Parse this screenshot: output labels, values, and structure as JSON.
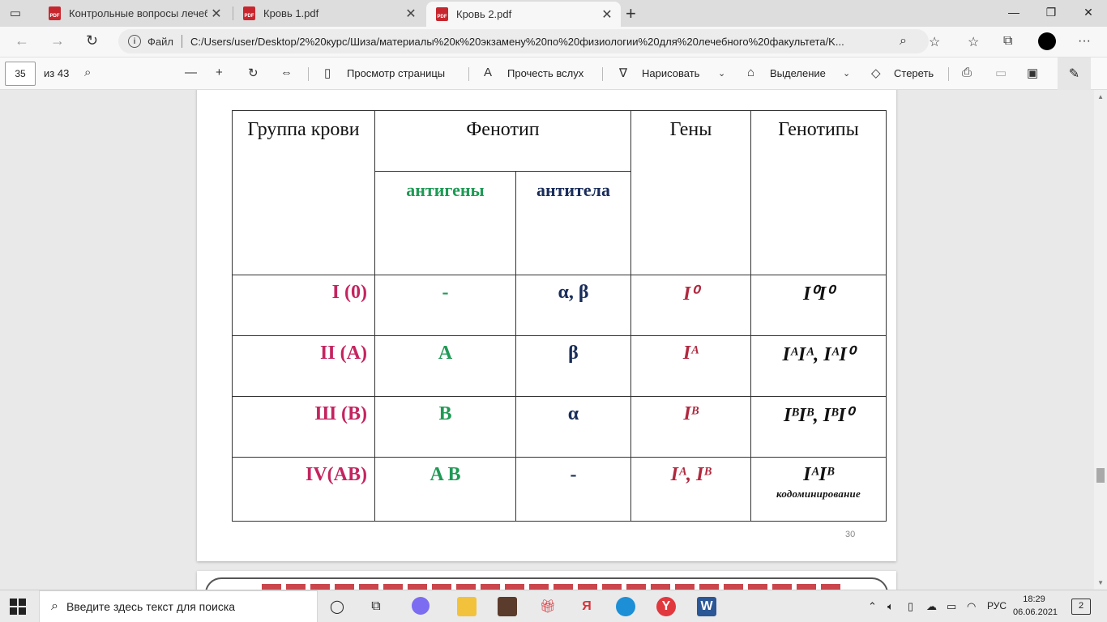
{
  "browser": {
    "tabs": [
      {
        "title": "Контрольные вопросы лечебн",
        "active": false
      },
      {
        "title": "Кровь 1.pdf",
        "active": false
      },
      {
        "title": "Кровь 2.pdf",
        "active": true
      }
    ],
    "address": {
      "label": "Файл",
      "url": "C:/Users/user/Desktop/2%20курс/Шиза/материалы%20к%20экзамену%20по%20физиологии%20для%20лечебного%20факультета/K..."
    }
  },
  "pdf_toolbar": {
    "page_current": "35",
    "page_total": "из 43",
    "page_view": "Просмотр страницы",
    "read_aloud": "Прочесть вслух",
    "draw": "Нарисовать",
    "highlight": "Выделение",
    "erase": "Стереть"
  },
  "table": {
    "headers": {
      "group": "Группа крови",
      "phenotype": "Фенотип",
      "antigens": "антигены",
      "antibodies": "антитела",
      "genes": "Гены",
      "genotypes": "Генотипы"
    },
    "rows": [
      {
        "group": "I (0)",
        "antigens": "-",
        "antibodies": "α, β",
        "genes": "I⁰",
        "genotypes": "I⁰I⁰"
      },
      {
        "group": "II (A)",
        "antigens": "A",
        "antibodies": "β",
        "genes": "Iᴬ",
        "genotypes": "IᴬIᴬ, IᴬI⁰"
      },
      {
        "group": "Ш (B)",
        "antigens": "B",
        "antibodies": "α",
        "genes": "Iᴮ",
        "genotypes": "IᴮIᴮ, IᴮI⁰"
      },
      {
        "group": "IV(AB)",
        "antigens": "A B",
        "antibodies": "-",
        "genes": "Iᴬ, Iᴮ",
        "genotypes": "IᴬIᴮ",
        "note": "кодоминирование"
      }
    ],
    "page_number": "30"
  },
  "taskbar": {
    "search_placeholder": "Введите здесь текст для поиска",
    "language": "РУС",
    "time": "18:29",
    "date": "06.06.2021",
    "notifications": "2"
  }
}
